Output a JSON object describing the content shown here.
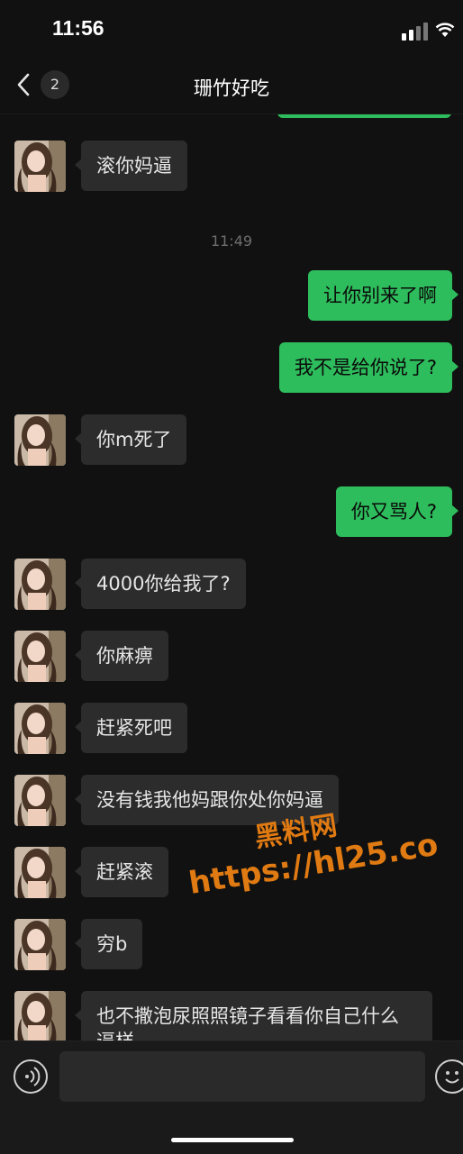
{
  "status_bar": {
    "time": "11:56"
  },
  "nav": {
    "unread_count": "2",
    "title": "珊竹好吃"
  },
  "messages": [
    {
      "dir": "in",
      "text": "滚你妈逼"
    },
    {
      "dir": "time",
      "text": "11:49"
    },
    {
      "dir": "out",
      "text": "让你别来了啊"
    },
    {
      "dir": "out",
      "text": "我不是给你说了?"
    },
    {
      "dir": "in",
      "text": "你m死了"
    },
    {
      "dir": "out",
      "text": "你又骂人?"
    },
    {
      "dir": "in",
      "text": "4000你给我了?"
    },
    {
      "dir": "in",
      "text": "你麻痹"
    },
    {
      "dir": "in",
      "text": "赶紧死吧"
    },
    {
      "dir": "in",
      "text": "没有钱我他妈跟你处你妈逼"
    },
    {
      "dir": "in",
      "text": "赶紧滚"
    },
    {
      "dir": "in",
      "text": "穷b"
    },
    {
      "dir": "in",
      "text": "也不撒泡尿照照镜子看看你自己什么逼样"
    }
  ],
  "watermark": {
    "line1": "黑料网",
    "line2": "https://hl25.co"
  },
  "icons": {
    "back": "chevron-left-icon",
    "voice": "voice-icon",
    "emoji": "emoji-icon"
  },
  "colors": {
    "sent_bubble": "#2ebd5c",
    "received_bubble": "#2c2c2c",
    "background": "#111111",
    "watermark": "#e07a12"
  }
}
